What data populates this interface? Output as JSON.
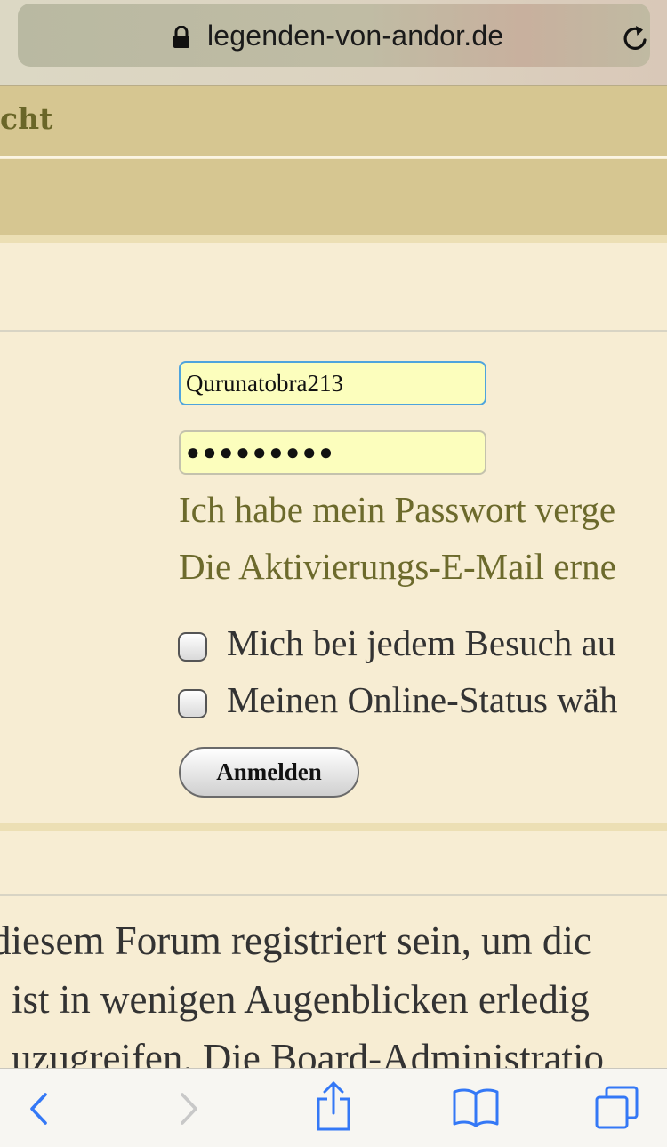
{
  "browser": {
    "url": "legenden-von-andor.de",
    "lock_icon": "lock-icon",
    "reload_icon": "reload-icon"
  },
  "forum": {
    "nav_partial_text": "cht"
  },
  "login": {
    "username_value": "Qurunatobra213",
    "password_value": "●●●●●●●●●",
    "forgot_password_link": "Ich habe mein Passwort verge",
    "resend_activation_link": "Die Aktivierungs-E-Mail erne",
    "auto_login_label": "Mich bei jedem Besuch au",
    "hide_online_label": "Meinen Online-Status wäh",
    "submit_label": "Anmelden"
  },
  "register_text": {
    "line1": "diesem Forum registriert sein, um dic",
    "line2": "ist in wenigen Augenblicken erledig",
    "line3": "uzugreifen. Die Board-Administratio"
  },
  "toolbar": {
    "items": [
      "back-icon",
      "forward-icon",
      "share-icon",
      "bookmarks-icon",
      "tabs-icon"
    ]
  },
  "colors": {
    "accent_blue": "#3478f6",
    "header_tan": "#d6c691",
    "page_bg": "#f7edd3",
    "link_olive": "#6c6a2c"
  }
}
